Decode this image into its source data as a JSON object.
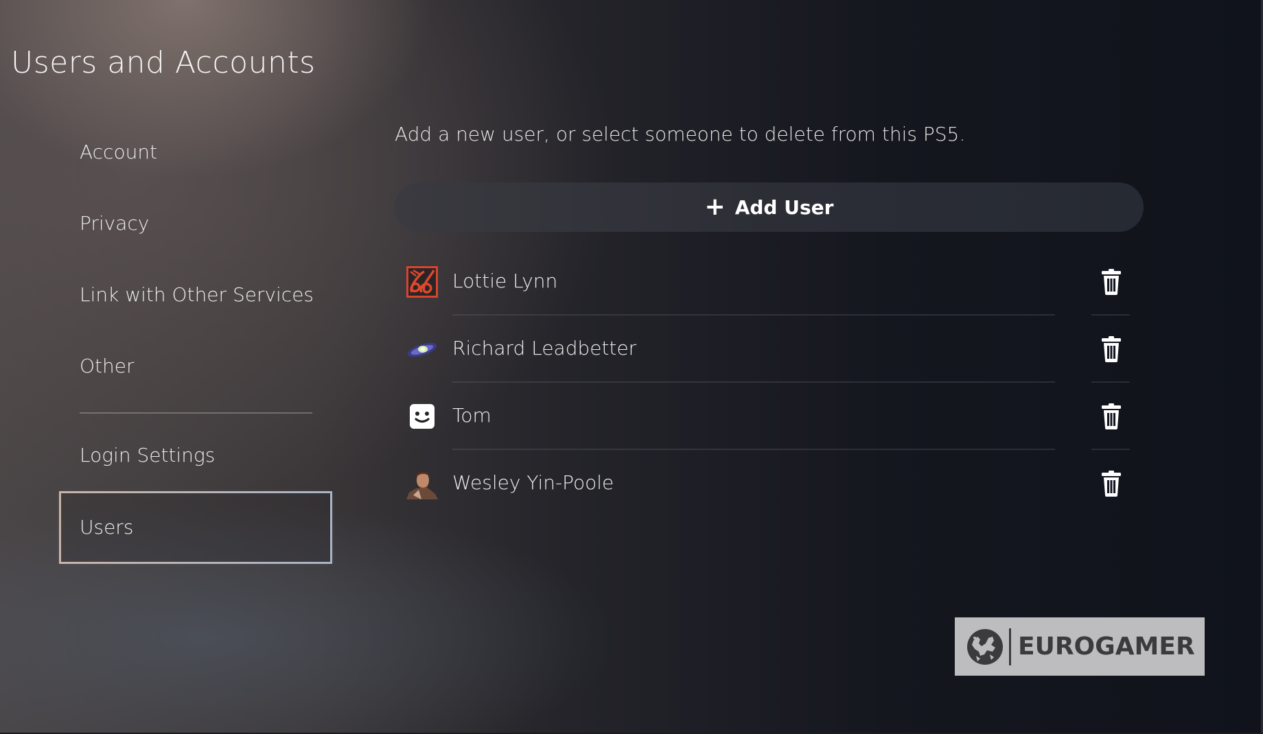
{
  "header": {
    "title": "Users and Accounts"
  },
  "sidebar": {
    "items": [
      {
        "label": "Account"
      },
      {
        "label": "Privacy"
      },
      {
        "label": "Link with Other Services"
      },
      {
        "label": "Other"
      },
      {
        "label": "Login Settings"
      },
      {
        "label": "Users",
        "selected": true
      }
    ]
  },
  "main": {
    "description": "Add a new user, or select someone to delete from this PS5.",
    "add_user": {
      "icon": "plus-icon",
      "label": "Add User"
    },
    "users": [
      {
        "name": "Lottie Lynn",
        "avatar": "red-emblem-avatar",
        "action_icon": "trash-icon"
      },
      {
        "name": "Richard Leadbetter",
        "avatar": "galaxy-avatar",
        "action_icon": "trash-icon"
      },
      {
        "name": "Tom",
        "avatar": "smiley-face-avatar",
        "action_icon": "trash-icon"
      },
      {
        "name": "Wesley Yin-Poole",
        "avatar": "character-portrait-avatar",
        "action_icon": "trash-icon"
      }
    ]
  },
  "watermark": {
    "icon": "europe-globe-icon",
    "text": "EUROGAMER"
  },
  "colors": {
    "text": "#f2f2f2",
    "button_bg": "#2f3038",
    "selection_border": "#b8b4b8",
    "watermark_bg": "#bdbdbf",
    "watermark_fg": "#3b3b3d",
    "lottie_avatar": "#e0432a"
  }
}
